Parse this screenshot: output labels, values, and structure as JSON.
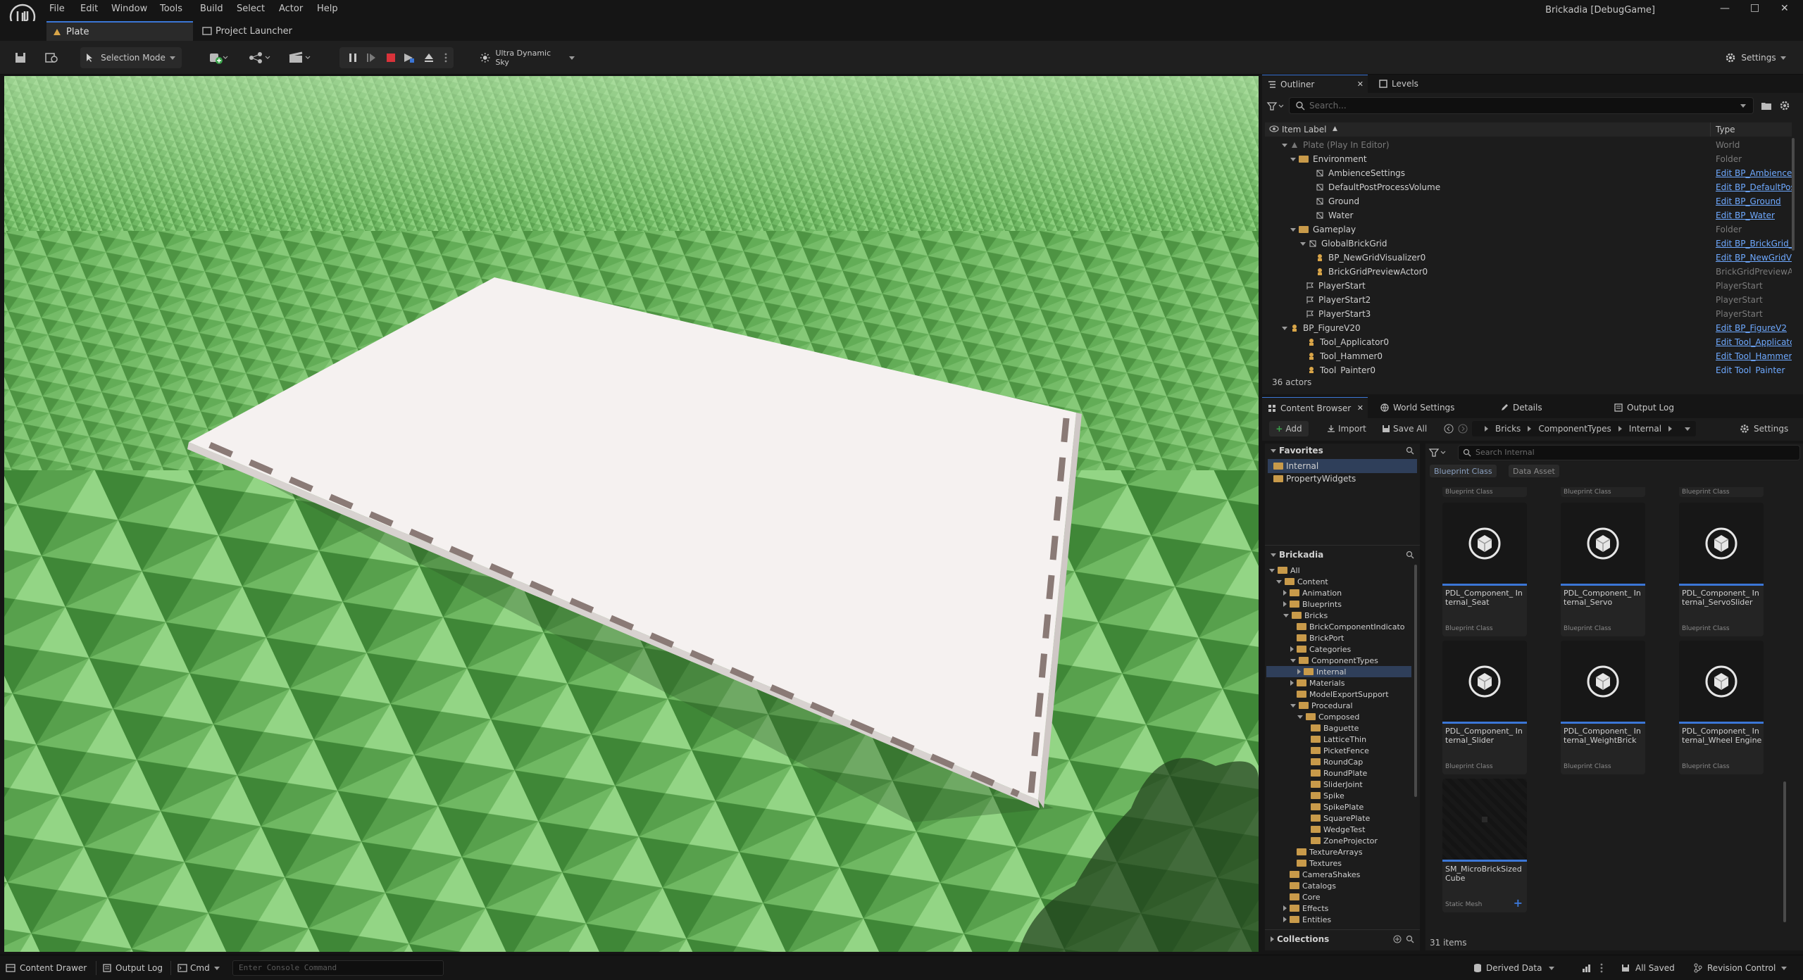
{
  "app": {
    "window_title": "Brickadia [DebugGame]"
  },
  "menu": [
    "File",
    "Edit",
    "Window",
    "Tools",
    "Build",
    "Select",
    "Actor",
    "Help"
  ],
  "doc_tabs": {
    "level": "Plate",
    "launcher": "Project Launcher"
  },
  "toolbar": {
    "selection_mode": "Selection Mode",
    "sky": "Ultra Dynamic Sky",
    "settings": "Settings"
  },
  "outliner": {
    "tab_outliner": "Outliner",
    "tab_levels": "Levels",
    "search_placeholder": "Search...",
    "col_label": "Item Label",
    "col_type": "Type",
    "rows": [
      {
        "label": "Plate (Play In Editor)",
        "type": "World",
        "link": false,
        "muted": true
      },
      {
        "label": "Environment",
        "type": "Folder",
        "link": false
      },
      {
        "label": "AmbienceSettings",
        "type": "Edit BP_AmbienceSettings",
        "link": true
      },
      {
        "label": "DefaultPostProcessVolume",
        "type": "Edit BP_DefaultPostProcessVolum",
        "link": true
      },
      {
        "label": "Ground",
        "type": "Edit BP_Ground",
        "link": true
      },
      {
        "label": "Water",
        "type": "Edit BP_Water",
        "link": true
      },
      {
        "label": "Gameplay",
        "type": "Folder",
        "link": false
      },
      {
        "label": "GlobalBrickGrid",
        "type": "Edit BP_BrickGrid_Global",
        "link": true
      },
      {
        "label": "BP_NewGridVisualizer0",
        "type": "Edit BP_NewGridVisualizer",
        "link": true
      },
      {
        "label": "BrickGridPreviewActor0",
        "type": "BrickGridPreviewActor",
        "link": false
      },
      {
        "label": "PlayerStart",
        "type": "PlayerStart",
        "link": false
      },
      {
        "label": "PlayerStart2",
        "type": "PlayerStart",
        "link": false
      },
      {
        "label": "PlayerStart3",
        "type": "PlayerStart",
        "link": false
      },
      {
        "label": "BP_FigureV20",
        "type": "Edit BP_FigureV2",
        "link": true
      },
      {
        "label": "Tool_Applicator0",
        "type": "Edit Tool_Applicator",
        "link": true
      },
      {
        "label": "Tool_Hammer0",
        "type": "Edit Tool_Hammer",
        "link": true
      },
      {
        "label": "Tool_Painter0",
        "type": "Edit Tool_Painter",
        "link": true
      }
    ],
    "count": "36 actors"
  },
  "content_browser": {
    "tab_content": "Content Browser",
    "tab_world": "World Settings",
    "tab_details": "Details",
    "tab_output": "Output Log",
    "add": "Add",
    "import": "Import",
    "save_all": "Save All",
    "settings": "Settings",
    "breadcrumb": [
      "Bricks",
      "ComponentTypes",
      "Internal"
    ],
    "favorites_title": "Favorites",
    "favorites": [
      "Internal",
      "PropertyWidgets"
    ],
    "root_title": "Brickadia",
    "tree": [
      {
        "label": "All",
        "depth": 0,
        "open": true
      },
      {
        "label": "Content",
        "depth": 1,
        "open": true
      },
      {
        "label": "Animation",
        "depth": 2
      },
      {
        "label": "Blueprints",
        "depth": 2
      },
      {
        "label": "Bricks",
        "depth": 2,
        "open": true
      },
      {
        "label": "BrickComponentIndicato",
        "depth": 3
      },
      {
        "label": "BrickPort",
        "depth": 3
      },
      {
        "label": "Categories",
        "depth": 3
      },
      {
        "label": "ComponentTypes",
        "depth": 3,
        "open": true
      },
      {
        "label": "Internal",
        "depth": 4,
        "selected": true
      },
      {
        "label": "Materials",
        "depth": 3
      },
      {
        "label": "ModelExportSupport",
        "depth": 3
      },
      {
        "label": "Procedural",
        "depth": 3,
        "open": true
      },
      {
        "label": "Composed",
        "depth": 4,
        "open": true
      },
      {
        "label": "Baguette",
        "depth": 5
      },
      {
        "label": "LatticeThin",
        "depth": 5
      },
      {
        "label": "PicketFence",
        "depth": 5
      },
      {
        "label": "RoundCap",
        "depth": 5
      },
      {
        "label": "RoundPlate",
        "depth": 5
      },
      {
        "label": "SliderJoint",
        "depth": 5
      },
      {
        "label": "Spike",
        "depth": 5
      },
      {
        "label": "SpikePlate",
        "depth": 5
      },
      {
        "label": "SquarePlate",
        "depth": 5
      },
      {
        "label": "WedgeTest",
        "depth": 5
      },
      {
        "label": "ZoneProjector",
        "depth": 5
      },
      {
        "label": "TextureArrays",
        "depth": 3
      },
      {
        "label": "Textures",
        "depth": 3
      },
      {
        "label": "CameraShakes",
        "depth": 2
      },
      {
        "label": "Catalogs",
        "depth": 2
      },
      {
        "label": "Core",
        "depth": 2
      },
      {
        "label": "Effects",
        "depth": 2
      },
      {
        "label": "Entities",
        "depth": 2
      }
    ],
    "collections": "Collections",
    "search_placeholder": "Search Internal",
    "filters": [
      "Blueprint Class",
      "Data Asset"
    ],
    "partial_class": "Blueprint Class",
    "assets": [
      {
        "name": "PDL_Component_ Internal_Seat",
        "class": "Blueprint Class"
      },
      {
        "name": "PDL_Component_ Internal_Servo",
        "class": "Blueprint Class"
      },
      {
        "name": "PDL_Component_ Internal_ServoSlider",
        "class": "Blueprint Class"
      },
      {
        "name": "PDL_Component_ Internal_Slider",
        "class": "Blueprint Class"
      },
      {
        "name": "PDL_Component_ Internal_WeightBrick",
        "class": "Blueprint Class"
      },
      {
        "name": "PDL_Component_ Internal_Wheel Engine",
        "class": "Blueprint Class"
      },
      {
        "name": "SM_MicroBrickSized Cube",
        "class": "Static Mesh"
      }
    ],
    "items_count": "31 items"
  },
  "statusbar": {
    "content_drawer": "Content Drawer",
    "output_log": "Output Log",
    "cmd": "Cmd",
    "console_placeholder": "Enter Console Command",
    "derived_data": "Derived Data",
    "all_saved": "All Saved",
    "revision_control": "Revision Control"
  },
  "colors": {
    "accent": "#3b76d6",
    "link": "#6ea9ff",
    "stop": "#d9333a",
    "folder": "#c89a4a",
    "grass": "#5aa84f"
  }
}
